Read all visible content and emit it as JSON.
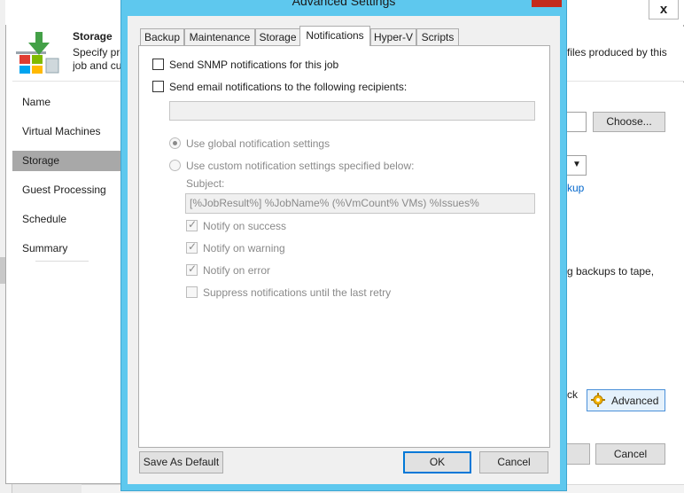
{
  "dialog": {
    "title": "Advanced Settings",
    "tabs": [
      {
        "label": "Backup"
      },
      {
        "label": "Maintenance"
      },
      {
        "label": "Storage"
      },
      {
        "label": "Notifications",
        "selected": true
      },
      {
        "label": "Hyper-V"
      },
      {
        "label": "Scripts"
      }
    ],
    "notifications": {
      "snmp_label": "Send SNMP notifications for this job",
      "email_label": "Send email notifications to the following recipients:",
      "recipients_value": "",
      "use_global_label": "Use global notification settings",
      "use_custom_label": "Use custom notification settings specified below:",
      "subject_label": "Subject:",
      "subject_value": "[%JobResult%] %JobName% (%VmCount% VMs) %Issues%",
      "notify_success_label": "Notify on success",
      "notify_warning_label": "Notify on warning",
      "notify_error_label": "Notify on error",
      "suppress_label": "Suppress notifications until the last retry"
    },
    "buttons": {
      "save_default": "Save As Default",
      "ok": "OK",
      "cancel": "Cancel"
    }
  },
  "wizard": {
    "close_glyph": "x",
    "header": {
      "title": "Storage",
      "desc_line1": "Specify pro",
      "desc_line2": "job and cu",
      "desc_right": "files produced by this"
    },
    "nav": [
      {
        "label": "Name"
      },
      {
        "label": "Virtual Machines"
      },
      {
        "label": "Storage",
        "active": true
      },
      {
        "label": "Guest Processing"
      },
      {
        "label": "Schedule"
      },
      {
        "label": "Summary"
      }
    ],
    "choose_button": "Choose...",
    "link_fragment": "kup",
    "tape_fragment": "g backups to tape,",
    "ck_fragment": "ck",
    "advanced_button": "Advanced",
    "cancel_button": "Cancel"
  },
  "colors": {
    "dialog_frame": "#5ec8ee",
    "close_red": "#c42b1c",
    "link_blue": "#0066cc",
    "nav_active": "#a8a8a8"
  }
}
